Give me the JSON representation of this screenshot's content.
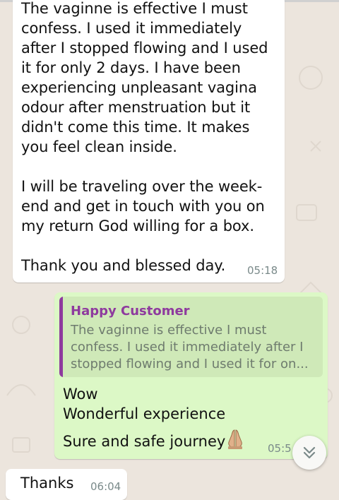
{
  "messages": {
    "incoming_1": {
      "text": "The vaginne is effective I must\nconfess. I used it immediately\nafter I stopped flowing and I used\nit for only 2 days. I have been\nexperiencing unpleasant vagina\nodour after menstruation but it\ndidn't come this time. It makes\nyou feel clean inside.\n\nI will be traveling over the week-\nend and get in touch with you on\nmy return God willing for a box.\n\nThank you and blessed day.",
      "time": "05:18"
    },
    "outgoing_1": {
      "quote": {
        "sender": "Happy Customer",
        "text": "The vaginne is effective I must\nconfess. I used it immediately after I\nstopped flowing and I used it for on..."
      },
      "line1": "Wow",
      "line2": "Wonderful experience",
      "line3": "Sure and safe journey",
      "emoji": "folded-hands-emoji",
      "time": "05:5"
    },
    "incoming_2": {
      "text": "Thanks",
      "time": "06:04"
    }
  },
  "scroll_down_button": {
    "icon": "double-chevron-down-icon"
  },
  "colors": {
    "chat_bg": "#ece5dd",
    "incoming_bubble": "#ffffff",
    "outgoing_bubble": "#dcf8c6",
    "quote_accent": "#8e3a9e",
    "timestamp": "#7a8a8a"
  }
}
